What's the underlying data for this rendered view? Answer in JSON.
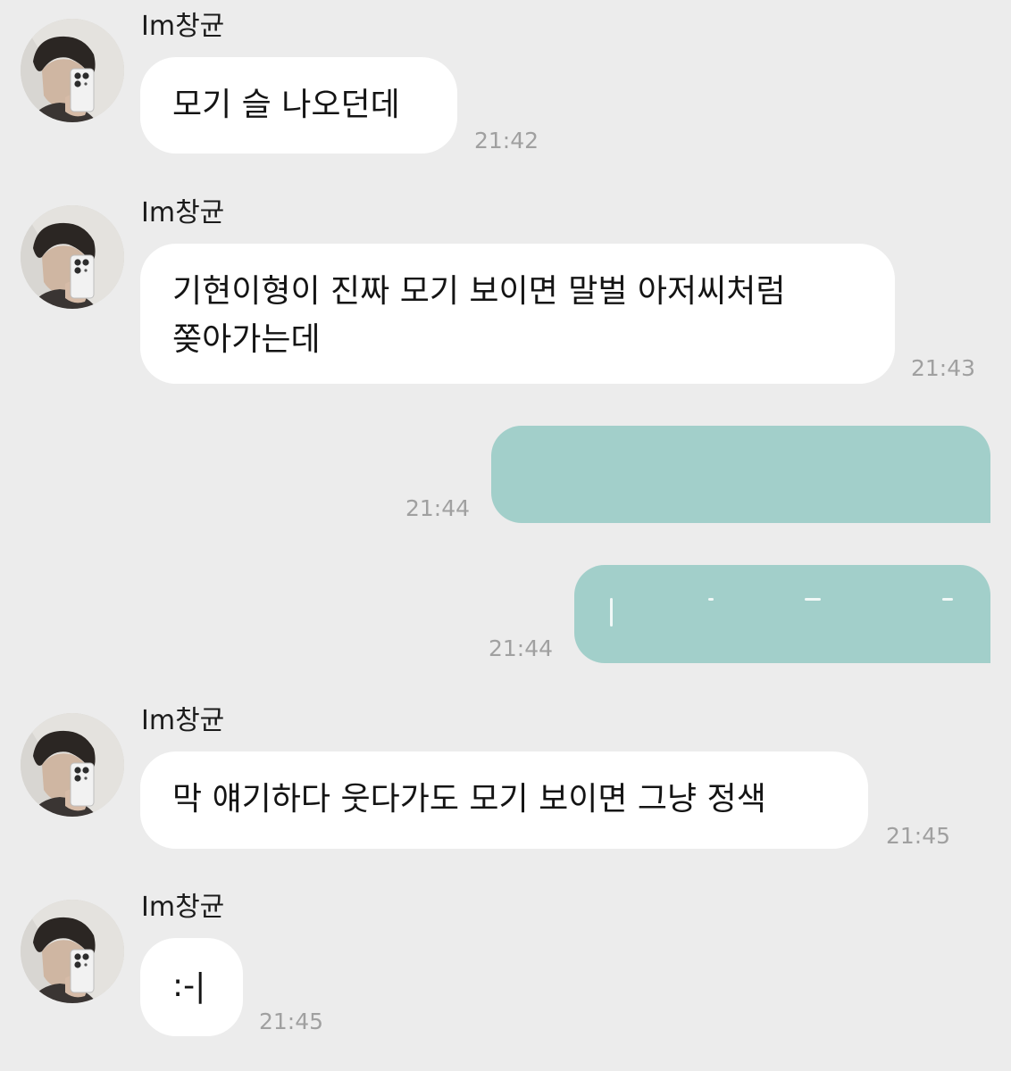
{
  "chat": {
    "contact_name": "Im창균",
    "avatar_icon": "profile-photo-mirror-selfie-icon",
    "colors": {
      "background": "#ececec",
      "incoming_bubble": "#ffffff",
      "outgoing_bubble": "#a2cfca",
      "timestamp": "#a0a0a0"
    },
    "messages": [
      {
        "sender": "Im창균",
        "direction": "incoming",
        "lines": [
          "모기 슬 나오던데"
        ],
        "time": "21:42"
      },
      {
        "sender": "Im창균",
        "direction": "incoming",
        "lines": [
          "기현이형이 진짜 모기 보이면 말벌 아저씨처럼",
          "쫒아가는데"
        ],
        "time": "21:43"
      },
      {
        "direction": "outgoing",
        "lines": [
          ""
        ],
        "time": "21:44"
      },
      {
        "direction": "outgoing",
        "lines": [
          ""
        ],
        "time": "21:44"
      },
      {
        "sender": "Im창균",
        "direction": "incoming",
        "lines": [
          "막 얘기하다 웃다가도 모기 보이면 그냥 정색"
        ],
        "time": "21:45"
      },
      {
        "sender": "Im창균",
        "direction": "incoming",
        "lines": [
          ":-|"
        ],
        "time": "21:45"
      }
    ]
  }
}
